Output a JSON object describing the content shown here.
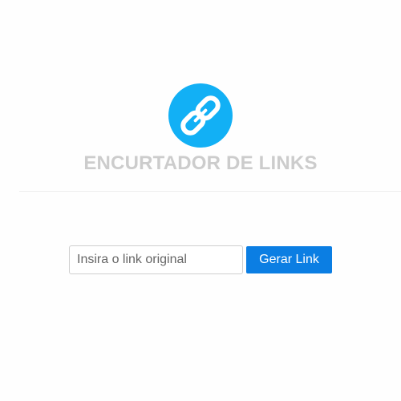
{
  "header": {
    "logo_icon": "chain-link-icon",
    "title": "ENCURTADOR DE LINKS"
  },
  "form": {
    "input_value": "",
    "input_placeholder": "Insira o link original",
    "button_label": "Gerar Link"
  },
  "colors": {
    "logo_background": "#12b0f5",
    "title_text": "#cccccc",
    "button_background": "#0b7ee3",
    "button_text": "#ffffff"
  }
}
